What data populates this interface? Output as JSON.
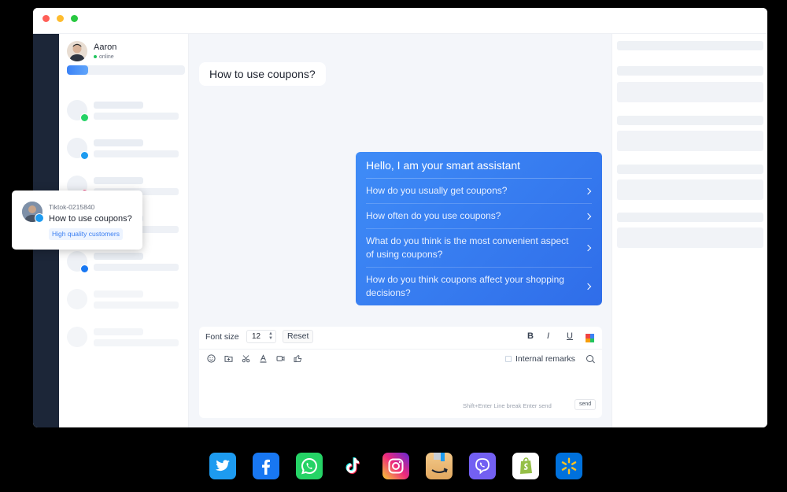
{
  "user": {
    "name": "Aaron",
    "status": "online"
  },
  "contact_badges": [
    {
      "icon": "whatsapp-icon",
      "color": "#25d366",
      "glyph": "w"
    },
    {
      "icon": "twitter-icon",
      "color": "#1d9bf0",
      "glyph": "t"
    },
    {
      "icon": "instagram-icon",
      "color": "#e1306c",
      "glyph": "i"
    },
    {
      "icon": "facebook-icon",
      "color": "#1877f2",
      "glyph": "f"
    }
  ],
  "chat": {
    "incoming_message": "How to use coupons?",
    "bot_title": "Hello, I am your smart assistant",
    "suggestions": [
      "How do you usually get coupons?",
      "How often do you use coupons?",
      "What do you think is the most convenient aspect of using coupons?",
      "How do you think coupons affect your shopping decisions?"
    ]
  },
  "composer": {
    "font_size_label": "Font size",
    "font_size_value": "12",
    "reset_label": "Reset",
    "bold": "B",
    "italic": "I",
    "underline": "U",
    "internal_remarks_label": "Internal remarks",
    "hint": "Shift+Enter Line break Enter send",
    "send_label": "send"
  },
  "popup": {
    "contact_id": "Tiktok-0215840",
    "message": "How to use coupons?",
    "tag": "High quality customers"
  },
  "platforms": [
    {
      "name": "twitter-icon",
      "color": "#1d9bf0"
    },
    {
      "name": "facebook-icon",
      "color": "#1877f2"
    },
    {
      "name": "whatsapp-icon",
      "color": "#25d366"
    },
    {
      "name": "tiktok-icon",
      "color": "#000000"
    },
    {
      "name": "instagram-icon",
      "color": "#e1306c"
    },
    {
      "name": "amazon-icon",
      "color": "#f0b770"
    },
    {
      "name": "viber-icon",
      "color": "#7360f2"
    },
    {
      "name": "shopify-icon",
      "color": "#ffffff"
    },
    {
      "name": "walmart-icon",
      "color": "#0071dc"
    }
  ]
}
